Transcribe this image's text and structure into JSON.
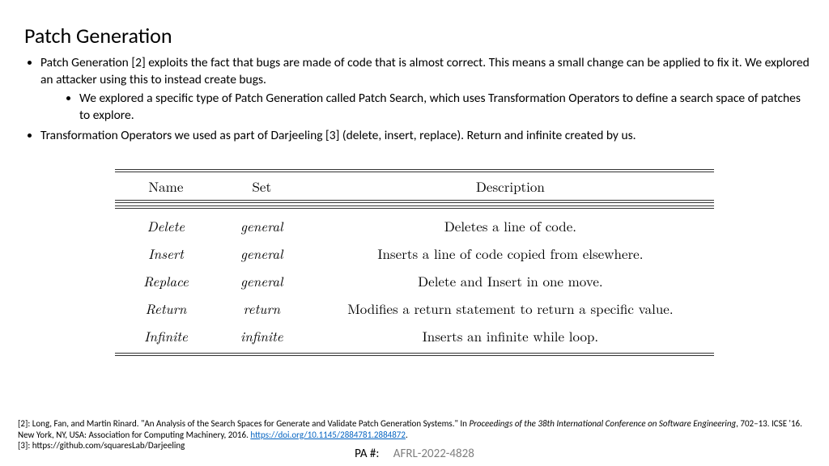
{
  "title": "Patch Generation",
  "bullets": {
    "b1": "Patch Generation [2] exploits the fact that bugs are made of code that is almost correct. This means a small change can be applied to fix it. We explored an attacker using this to instead create bugs.",
    "b1a": "We explored a specific type of Patch Generation called Patch Search, which uses Transformation Operators to define a search space of patches to explore.",
    "b2": "Transformation Operators we used as part of Darjeeling [3] (delete, insert, replace). Return and infinite created by us."
  },
  "table": {
    "headers": {
      "name": "Name",
      "set": "Set",
      "desc": "Description"
    },
    "rows": [
      {
        "name": "Delete",
        "set": "general",
        "desc": "Deletes a line of code."
      },
      {
        "name": "Insert",
        "set": "general",
        "desc": "Inserts a line of code copied from elsewhere."
      },
      {
        "name": "Replace",
        "set": "general",
        "desc": "Delete and Insert in one move."
      },
      {
        "name": "Return",
        "set": "return",
        "desc": "Modifies a return statement to return a specific value."
      },
      {
        "name": "Infinite",
        "set": "infinite",
        "desc": "Inserts an infinite while loop."
      }
    ]
  },
  "refs": {
    "r2a": "[2]: Long, Fan, and Martin Rinard. \"An Analysis of the Search Spaces for Generate and Validate Patch Generation Systems.\" In ",
    "r2em": "Proceedings of the 38th International Conference on Software Engineering",
    "r2b": ", 702–13. ICSE '16. New York, NY, USA: Association for Computing Machinery, 2016. ",
    "r2link": "https://doi.org/10.1145/2884781.2884872",
    "r2c": ".",
    "r3": "[3]: https://github.com/squaresLab/Darjeeling"
  },
  "pa": {
    "label": "PA #:",
    "number": "AFRL-2022-4828"
  }
}
